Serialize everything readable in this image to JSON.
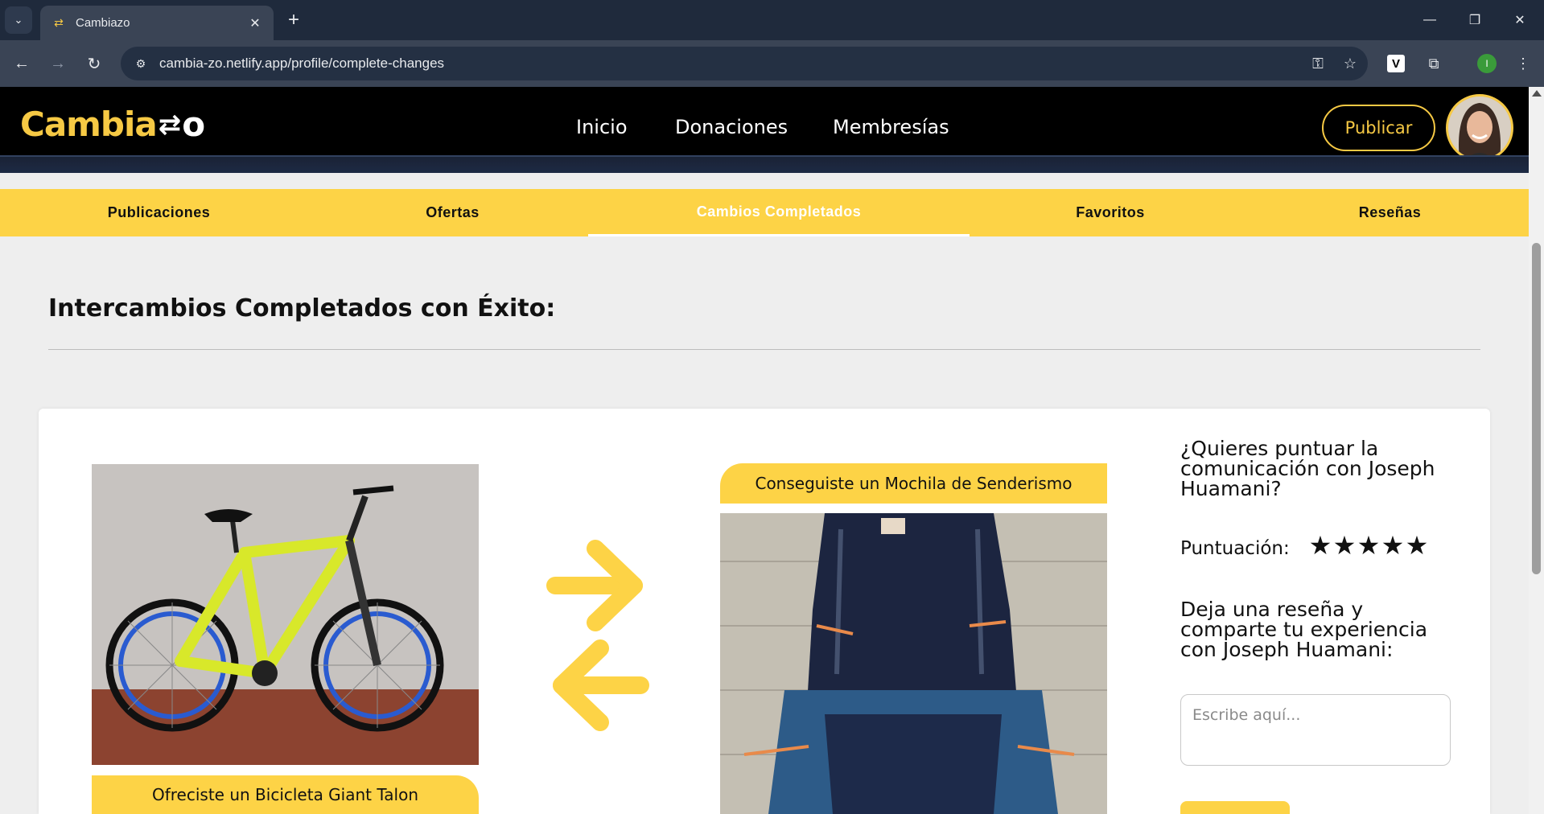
{
  "browser": {
    "tab_title": "Cambiazo",
    "url": "cambia-zo.netlify.app/profile/complete-changes",
    "profile_initial": "I",
    "ext_v_label": "V"
  },
  "site": {
    "logo_text": "Cambia",
    "logo_suffix": "o",
    "nav": [
      "Inicio",
      "Donaciones",
      "Membresías"
    ],
    "publish_label": "Publicar",
    "accent_color": "#fdd346"
  },
  "profile_tabs": [
    "Publicaciones",
    "Ofertas",
    "Cambios Completados",
    "Favoritos",
    "Reseñas"
  ],
  "active_tab": "Cambios Completados",
  "content": {
    "section_title": "Intercambios Completados con Éxito:",
    "exchange": {
      "offered_label": "Ofreciste un Bicicleta Giant Talon",
      "got_label": "Conseguiste un Mochila de Senderismo",
      "rate_question": "¿Quieres puntuar la comunicación con Joseph Huamani?",
      "score_label": "Puntuación:",
      "stars": [
        "★",
        "★",
        "★",
        "★",
        "★"
      ],
      "review_question": "Deja una reseña y comparte tu experiencia con Joseph Huamani:",
      "review_placeholder": "Escribe aquí..."
    }
  }
}
